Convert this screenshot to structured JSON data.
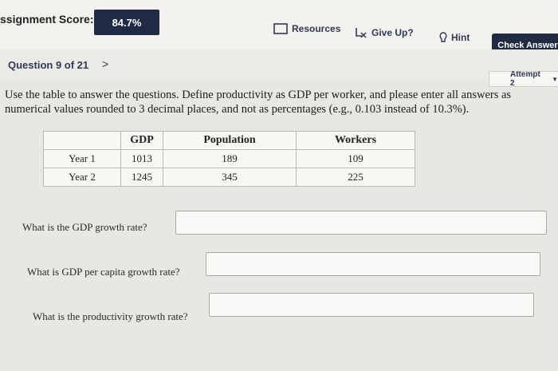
{
  "header": {
    "score_label": "ssignment Score:",
    "score_value": "84.7%",
    "resources_label": "Resources",
    "give_up_label": "Give Up?",
    "hint_label": "Hint",
    "check_answer_label": "Check Answer"
  },
  "question": {
    "label": "Question 9 of 21",
    "next_chevron": ">",
    "attempt_label": "Attempt 2",
    "instructions": "Use the table to answer the questions. Define productivity as GDP per worker, and please enter all answers as numerical values rounded to 3 decimal places, and not as percentages (e.g., 0.103 instead of 10.3%)."
  },
  "table": {
    "headers": [
      "",
      "GDP",
      "Population",
      "Workers"
    ],
    "rows": [
      [
        "Year 1",
        "1013",
        "189",
        "109"
      ],
      [
        "Year 2",
        "1245",
        "345",
        "225"
      ]
    ]
  },
  "prompts": {
    "gdp_growth": "What is the GDP growth rate?",
    "gdp_per_capita_growth": "What is GDP per capita growth rate?",
    "productivity_growth": "What is the productivity growth rate?"
  },
  "icons": {
    "resources": "folder-icon",
    "give_up": "function-icon",
    "hint": "lightbulb-icon"
  },
  "colors": {
    "primary_button": "#1f2a44",
    "link_text": "#2f3a57"
  }
}
